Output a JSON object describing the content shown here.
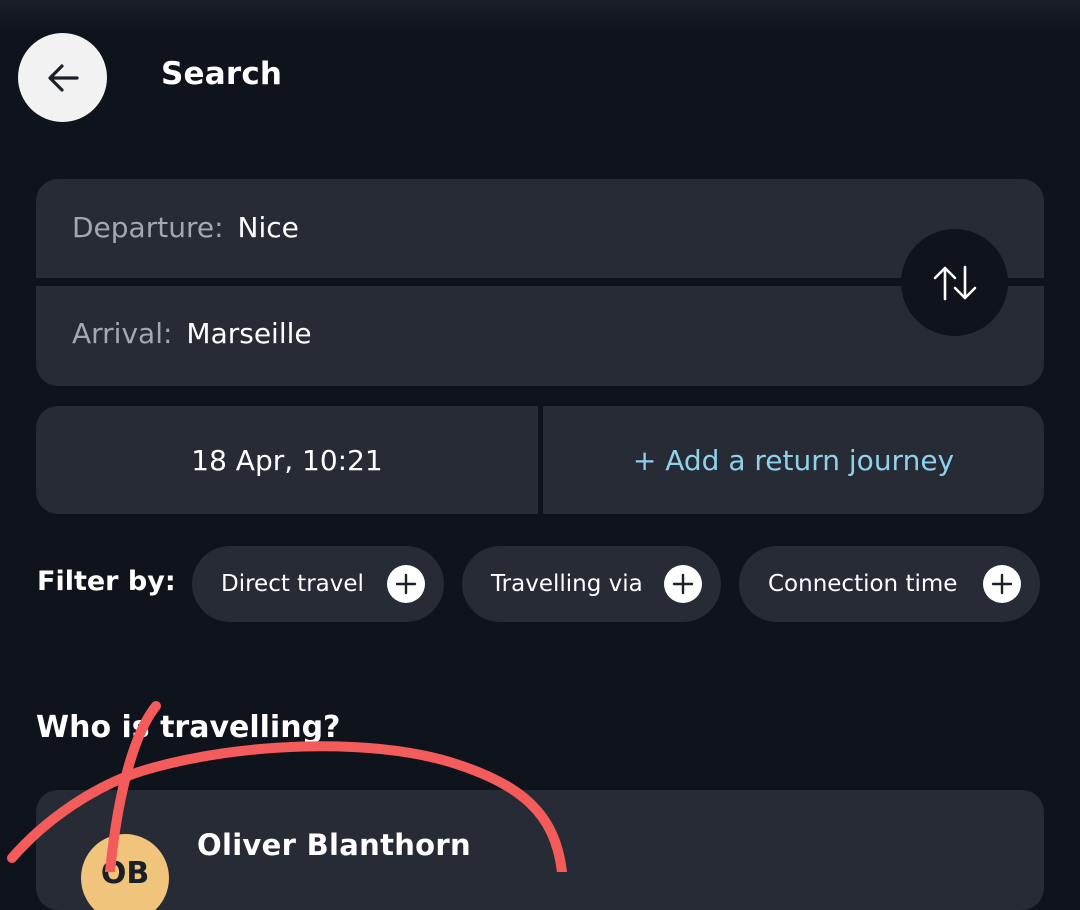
{
  "header": {
    "title": "Search"
  },
  "route": {
    "departure_label": "Departure:",
    "departure_value": "Nice",
    "arrival_label": "Arrival:",
    "arrival_value": "Marseille"
  },
  "date": {
    "value": "18 Apr, 10:21",
    "return_label": "+ Add a return journey"
  },
  "filters": {
    "label": "Filter by:",
    "chips": [
      {
        "label": "Direct travel"
      },
      {
        "label": "Travelling via"
      },
      {
        "label": "Connection time"
      }
    ]
  },
  "passengers": {
    "title": "Who is travelling?",
    "items": [
      {
        "initials": "OB",
        "name": "Oliver Blanthorn"
      }
    ]
  },
  "icons": {
    "back": "arrow-left-icon",
    "swap": "swap-vertical-icon",
    "add": "plus-icon"
  },
  "colors": {
    "background": "#0e131c",
    "card": "#262b35",
    "accent_link": "#8fd0ea",
    "avatar": "#f0c47b",
    "annotation": "#f45b5b"
  }
}
